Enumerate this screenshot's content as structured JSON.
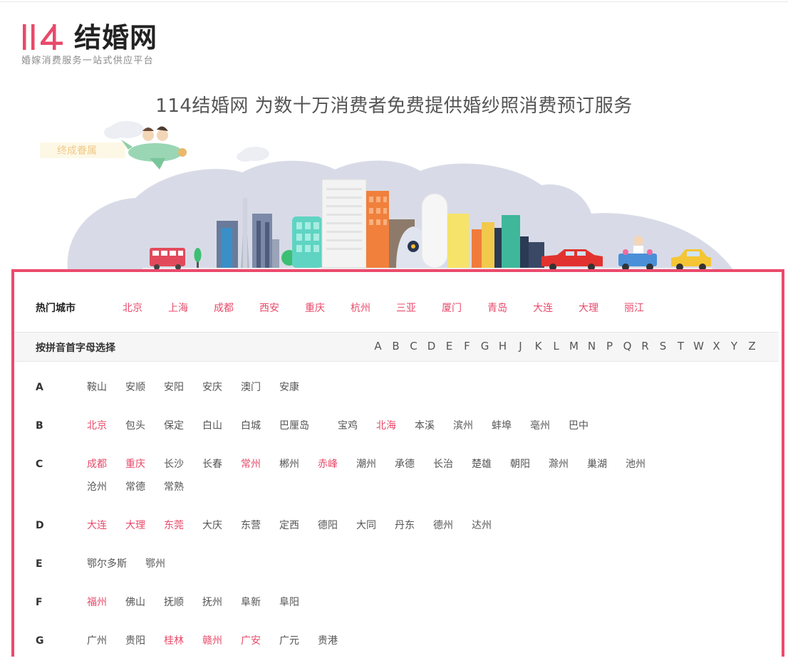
{
  "logo": {
    "mark_text": "114",
    "name": "结婚网",
    "slogan": "婚嫁消费服务一站式供应平台",
    "brand_color": "#e84a6a"
  },
  "headline": "114结婚网 为数十万消费者免费提供婚纱照消费预订服务",
  "banner": {
    "plane_text": "终成眷属"
  },
  "hot_cities": {
    "title": "热门城市",
    "items": [
      "北京",
      "上海",
      "成都",
      "西安",
      "重庆",
      "杭州",
      "三亚",
      "厦门",
      "青岛",
      "大连",
      "大理",
      "丽江"
    ]
  },
  "pinyin": {
    "title": "按拼音首字母选择",
    "letters": [
      "A",
      "B",
      "C",
      "D",
      "E",
      "F",
      "G",
      "H",
      "J",
      "K",
      "L",
      "M",
      "N",
      "P",
      "Q",
      "R",
      "S",
      "T",
      "W",
      "X",
      "Y",
      "Z"
    ]
  },
  "groups": [
    {
      "letter": "A",
      "cities": [
        {
          "name": "鞍山",
          "hot": false
        },
        {
          "name": "安顺",
          "hot": false
        },
        {
          "name": "安阳",
          "hot": false
        },
        {
          "name": "安庆",
          "hot": false
        },
        {
          "name": "澳门",
          "hot": false
        },
        {
          "name": "安康",
          "hot": false
        }
      ]
    },
    {
      "letter": "B",
      "cities": [
        {
          "name": "北京",
          "hot": true
        },
        {
          "name": "包头",
          "hot": false
        },
        {
          "name": "保定",
          "hot": false
        },
        {
          "name": "白山",
          "hot": false
        },
        {
          "name": "白城",
          "hot": false
        },
        {
          "name": "巴厘岛",
          "hot": false
        },
        {
          "name": "宝鸡",
          "hot": false
        },
        {
          "name": "北海",
          "hot": true
        },
        {
          "name": "本溪",
          "hot": false
        },
        {
          "name": "滨州",
          "hot": false
        },
        {
          "name": "蚌埠",
          "hot": false
        },
        {
          "name": "亳州",
          "hot": false
        },
        {
          "name": "巴中",
          "hot": false
        }
      ]
    },
    {
      "letter": "C",
      "cities": [
        {
          "name": "成都",
          "hot": true
        },
        {
          "name": "重庆",
          "hot": true
        },
        {
          "name": "长沙",
          "hot": false
        },
        {
          "name": "长春",
          "hot": false
        },
        {
          "name": "常州",
          "hot": true
        },
        {
          "name": "郴州",
          "hot": false
        },
        {
          "name": "赤峰",
          "hot": true
        },
        {
          "name": "潮州",
          "hot": false
        },
        {
          "name": "承德",
          "hot": false
        },
        {
          "name": "长治",
          "hot": false
        },
        {
          "name": "楚雄",
          "hot": false
        },
        {
          "name": "朝阳",
          "hot": false
        },
        {
          "name": "滁州",
          "hot": false
        },
        {
          "name": "巢湖",
          "hot": false
        },
        {
          "name": "池州",
          "hot": false
        },
        {
          "name": "沧州",
          "hot": false
        },
        {
          "name": "常德",
          "hot": false
        },
        {
          "name": "常熟",
          "hot": false
        }
      ]
    },
    {
      "letter": "D",
      "cities": [
        {
          "name": "大连",
          "hot": true
        },
        {
          "name": "大理",
          "hot": true
        },
        {
          "name": "东莞",
          "hot": true
        },
        {
          "name": "大庆",
          "hot": false
        },
        {
          "name": "东营",
          "hot": false
        },
        {
          "name": "定西",
          "hot": false
        },
        {
          "name": "德阳",
          "hot": false
        },
        {
          "name": "大同",
          "hot": false
        },
        {
          "name": "丹东",
          "hot": false
        },
        {
          "name": "德州",
          "hot": false
        },
        {
          "name": "达州",
          "hot": false
        }
      ]
    },
    {
      "letter": "E",
      "cities": [
        {
          "name": "鄂尔多斯",
          "hot": false
        },
        {
          "name": "鄂州",
          "hot": false
        }
      ]
    },
    {
      "letter": "F",
      "cities": [
        {
          "name": "福州",
          "hot": true
        },
        {
          "name": "佛山",
          "hot": false
        },
        {
          "name": "抚顺",
          "hot": false
        },
        {
          "name": "抚州",
          "hot": false
        },
        {
          "name": "阜新",
          "hot": false
        },
        {
          "name": "阜阳",
          "hot": false
        }
      ]
    },
    {
      "letter": "G",
      "cities": [
        {
          "name": "广州",
          "hot": false
        },
        {
          "name": "贵阳",
          "hot": false
        },
        {
          "name": "桂林",
          "hot": true
        },
        {
          "name": "赣州",
          "hot": true
        },
        {
          "name": "广安",
          "hot": true
        },
        {
          "name": "广元",
          "hot": false
        },
        {
          "name": "贵港",
          "hot": false
        }
      ]
    }
  ],
  "colors": {
    "accent": "#e84a6a",
    "panel_border": "#ec4a6c",
    "cloud": "#d8dbe7"
  }
}
